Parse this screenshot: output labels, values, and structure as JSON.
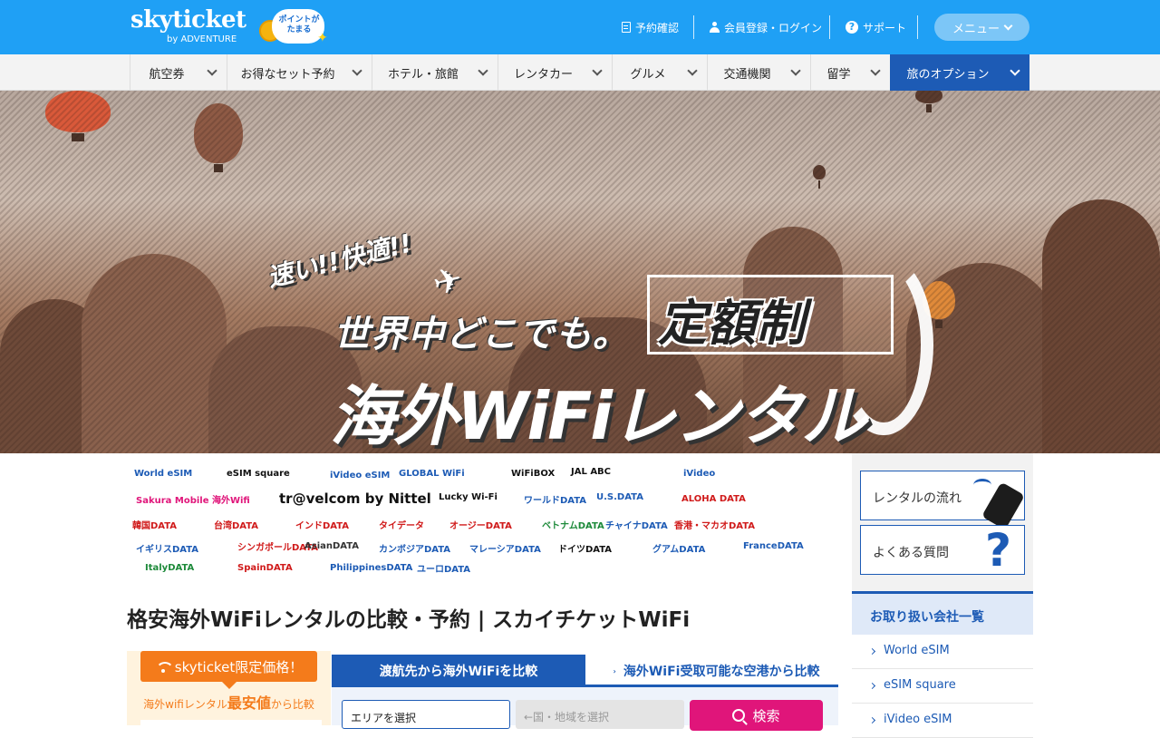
{
  "header": {
    "logo": "skyticket",
    "logo_sub": "by ADVENTURE",
    "points_badge": "ポイントが たまる",
    "reservation_confirm": "予約確認",
    "member_login": "会員登録・ログイン",
    "support": "サポート",
    "menu": "メニュー"
  },
  "nav": {
    "items": [
      {
        "label": "航空券"
      },
      {
        "label": "お得なセット予約"
      },
      {
        "label": "ホテル・旅館"
      },
      {
        "label": "レンタカー"
      },
      {
        "label": "グルメ"
      },
      {
        "label": "交通機関"
      },
      {
        "label": "留学"
      },
      {
        "label": "旅のオプション",
        "active": true
      }
    ]
  },
  "hero": {
    "line1": "速い!!快適!!",
    "line2": "世界中どこでも。",
    "line3": "定額制",
    "line4": "海外WiFiレンタル"
  },
  "providers": [
    {
      "name": "World eSIM",
      "color": "#1d5bb5"
    },
    {
      "name": "eSIM square",
      "color": "#111111"
    },
    {
      "name": "iVideo eSIM",
      "color": "#1d5bb5"
    },
    {
      "name": "GLOBAL WiFi",
      "color": "#1d5bb5"
    },
    {
      "name": "WiFiBOX",
      "color": "#111111"
    },
    {
      "name": "JAL ABC",
      "color": "#111111"
    },
    {
      "name": "iVideo",
      "color": "#1d5bb5"
    },
    {
      "name": "Sakura Mobile 海外Wifi",
      "color": "#e0157a"
    },
    {
      "name": "tr@velcom by Nittel",
      "color": "#111111"
    },
    {
      "name": "Lucky Wi-Fi",
      "color": "#111111"
    },
    {
      "name": "ワールドDATA",
      "color": "#1d5bb5"
    },
    {
      "name": "U.S.DATA",
      "color": "#1d5bb5"
    },
    {
      "name": "ALOHA DATA",
      "color": "#d01a1a"
    },
    {
      "name": "韓国DATA",
      "color": "#d01a1a"
    },
    {
      "name": "台湾DATA",
      "color": "#d01a1a"
    },
    {
      "name": "インドDATA",
      "color": "#d01a1a"
    },
    {
      "name": "タイデータ",
      "color": "#d01a1a"
    },
    {
      "name": "オージーDATA",
      "color": "#d01a1a"
    },
    {
      "name": "ベトナムDATA",
      "color": "#1d8a3a"
    },
    {
      "name": "チャイナDATA",
      "color": "#1d5bb5"
    },
    {
      "name": "香港・マカオDATA",
      "color": "#d01a1a"
    },
    {
      "name": "イギリスDATA",
      "color": "#1d5bb5"
    },
    {
      "name": "シンガポールDATA",
      "color": "#d01a1a"
    },
    {
      "name": "AsianDATA",
      "color": "#333333"
    },
    {
      "name": "カンボジアDATA",
      "color": "#1d5bb5"
    },
    {
      "name": "マレーシアDATA",
      "color": "#1d5bb5"
    },
    {
      "name": "ドイツDATA",
      "color": "#111111"
    },
    {
      "name": "グアムDATA",
      "color": "#1d5bb5"
    },
    {
      "name": "FranceDATA",
      "color": "#1d5bb5"
    },
    {
      "name": "ItalyDATA",
      "color": "#1d8a3a"
    },
    {
      "name": "SpainDATA",
      "color": "#d01a1a"
    },
    {
      "name": "PhilippinesDATA",
      "color": "#1d5bb5"
    },
    {
      "name": "ユーロDATA",
      "color": "#1d5bb5"
    }
  ],
  "page_title": "格安海外WiFiレンタルの比較・予約 | スカイチケットWiFi",
  "promo": {
    "badge": "skyticket限定価格！",
    "sub_prefix": "海外wifiレンタル",
    "sub_big": "最安値",
    "sub_suffix": "から比較"
  },
  "search": {
    "tab_destination": "渡航先から海外WiFiを比較",
    "tab_airport": "海外WiFi受取可能な空港から比較",
    "area_placeholder": "エリアを選択",
    "region_placeholder": "←国・地域を選択",
    "button": "検索"
  },
  "sidebar": {
    "flow": "レンタルの流れ",
    "faq": "よくある質問",
    "companies_heading": "お取り扱い会社一覧",
    "companies": [
      "World eSIM",
      "eSIM square",
      "iVideo eSIM"
    ]
  },
  "colors": {
    "header_blue": "#1fa0f5",
    "nav_active": "#1d5bb5",
    "promo_orange": "#f47b1b",
    "search_pink": "#e0157a"
  }
}
